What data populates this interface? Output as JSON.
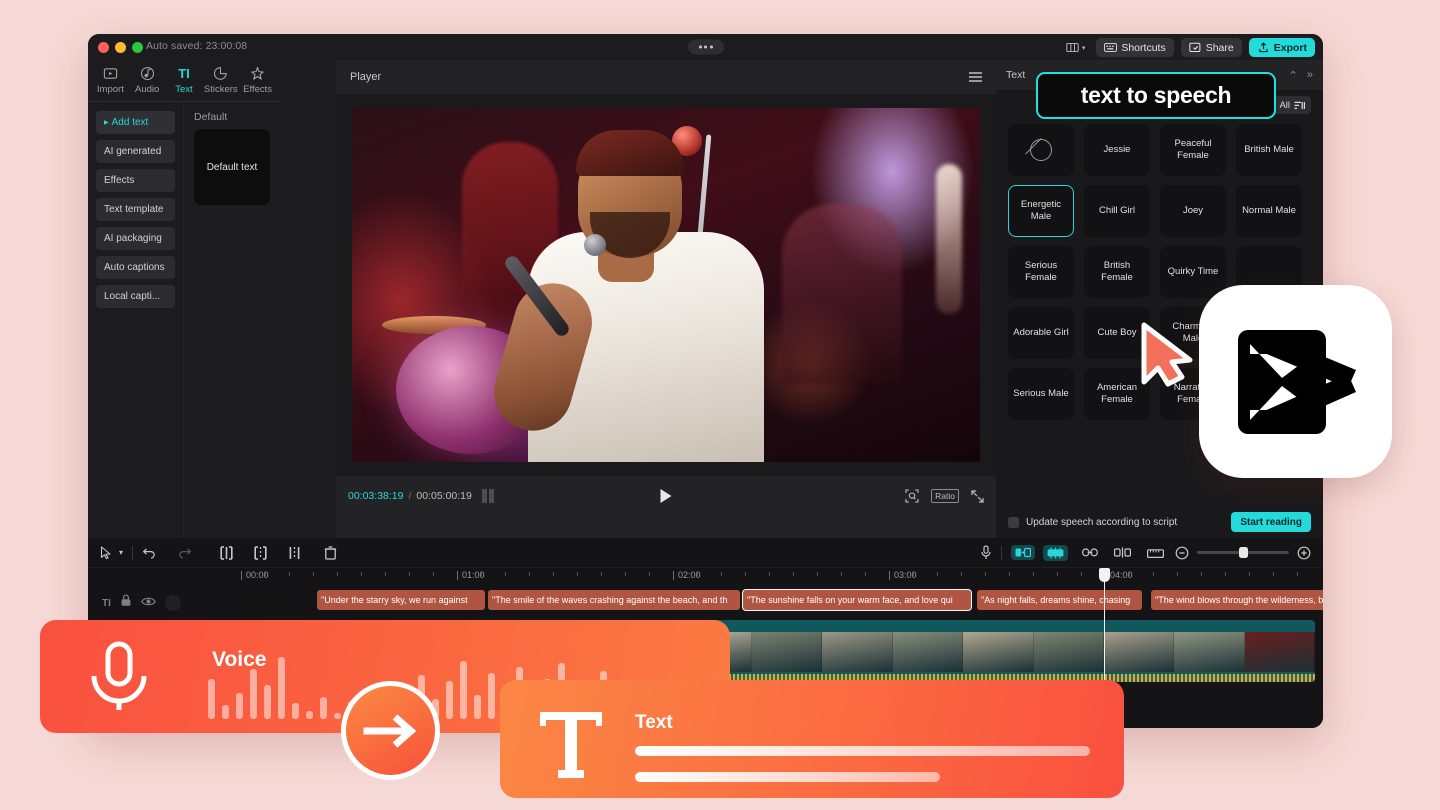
{
  "window": {
    "autosave": "Auto saved: 23:00:08",
    "traffic": [
      "close",
      "minimize",
      "maximize"
    ],
    "toolbar": {
      "layout_icon": "layout-icon",
      "shortcuts": "Shortcuts",
      "share": "Share",
      "export": "Export"
    }
  },
  "left": {
    "tabs": [
      {
        "label": "Import",
        "icon": "import-icon",
        "active": false
      },
      {
        "label": "Audio",
        "icon": "audio-icon",
        "active": false
      },
      {
        "label": "Text",
        "icon": "text-icon",
        "active": true
      },
      {
        "label": "Stickers",
        "icon": "stickers-icon",
        "active": false
      },
      {
        "label": "Effects",
        "icon": "effects-icon",
        "active": false
      }
    ],
    "categories": [
      {
        "label": "Add text",
        "active": true
      },
      {
        "label": "AI generated",
        "active": false
      },
      {
        "label": "Effects",
        "active": false
      },
      {
        "label": "Text template",
        "active": false
      },
      {
        "label": "AI packaging",
        "active": false
      },
      {
        "label": "Auto captions",
        "active": false
      },
      {
        "label": "Local capti...",
        "active": false
      }
    ],
    "preset_group_title": "Default",
    "preset_card_label": "Default text"
  },
  "player": {
    "title": "Player",
    "menu_icon": "hamburger-icon",
    "current_time": "00:03:38:19",
    "separator": "/",
    "total_time": "00:05:00:19",
    "frame_icon": "frames-icon",
    "play_icon": "play-icon",
    "zoom_icon": "zoom-fit-icon",
    "ratio_label": "Ratio",
    "fullscreen_icon": "fullscreen-icon"
  },
  "right": {
    "title": "Text",
    "collapse_icons": [
      "chevron-up-icon",
      "chevrons-right-icon"
    ],
    "filter_label": "All",
    "filter_icon": "filter-icon",
    "voices": [
      {
        "label": "",
        "icon": "none-icon",
        "selected": false
      },
      {
        "label": "Jessie",
        "selected": false
      },
      {
        "label": "Peaceful Female",
        "selected": false
      },
      {
        "label": "British Male",
        "selected": false
      },
      {
        "label": "Energetic Male",
        "selected": true
      },
      {
        "label": "Chill Girl",
        "selected": false
      },
      {
        "label": "Joey",
        "selected": false
      },
      {
        "label": "Normal Male",
        "selected": false
      },
      {
        "label": "Serious Female",
        "selected": false
      },
      {
        "label": "British Female",
        "selected": false
      },
      {
        "label": "Quirky Time",
        "selected": false
      },
      {
        "label": "",
        "selected": false
      },
      {
        "label": "Adorable Girl",
        "selected": false
      },
      {
        "label": "Cute Boy",
        "selected": false
      },
      {
        "label": "Charming Male",
        "selected": false
      },
      {
        "label": "",
        "selected": false
      },
      {
        "label": "Serious Male",
        "selected": false
      },
      {
        "label": "American Female",
        "selected": false
      },
      {
        "label": "Narrative Female",
        "selected": false
      },
      {
        "label": "",
        "selected": false
      }
    ],
    "update_checkbox_label": "Update speech according to script",
    "start_reading_label": "Start reading"
  },
  "timeline": {
    "tools": [
      "select-arrow-icon",
      "chevron-down-icon",
      "undo-icon",
      "redo-icon",
      "split-icon",
      "trim-left-icon",
      "trim-right-icon",
      "delete-icon"
    ],
    "right_tools": [
      "microphone-icon",
      "auto-transition-icon",
      "mixer-icon",
      "link-icon",
      "mirror-icon",
      "crop-icon",
      "zoom-out-icon",
      "zoom-in-icon"
    ],
    "ruler_labels": [
      "00:00",
      "01:00",
      "02:00",
      "03:00",
      "04:00"
    ],
    "track_header_icons": [
      "text-track-icon",
      "lock-icon",
      "eye-icon"
    ],
    "text_clips": [
      "\"Under the starry sky, we run against",
      "\"The smile of the waves crashing against the beach, and th",
      "\"The sunshine falls on your warm face, and love qui",
      "\"As night falls, dreams shine, chasing",
      "\"The wind blows through the wilderness, bringing distant"
    ],
    "selected_clip_index": 2,
    "zoom_level_position": "45"
  },
  "promo": {
    "tts_callout": "text to speech",
    "voice_banner": {
      "label": "Voice",
      "icon": "microphone-icon"
    },
    "arrow_icon": "arrow-right-icon",
    "text_banner": {
      "label": "Text",
      "icon": "text-T-icon"
    },
    "logo": "capcut-logo"
  },
  "colors": {
    "accent": "#23dbdb",
    "promo_orange": "#fb6b41",
    "promo_red": "#f9503f",
    "clip_red": "#b15543",
    "video_track": "#10585c"
  }
}
